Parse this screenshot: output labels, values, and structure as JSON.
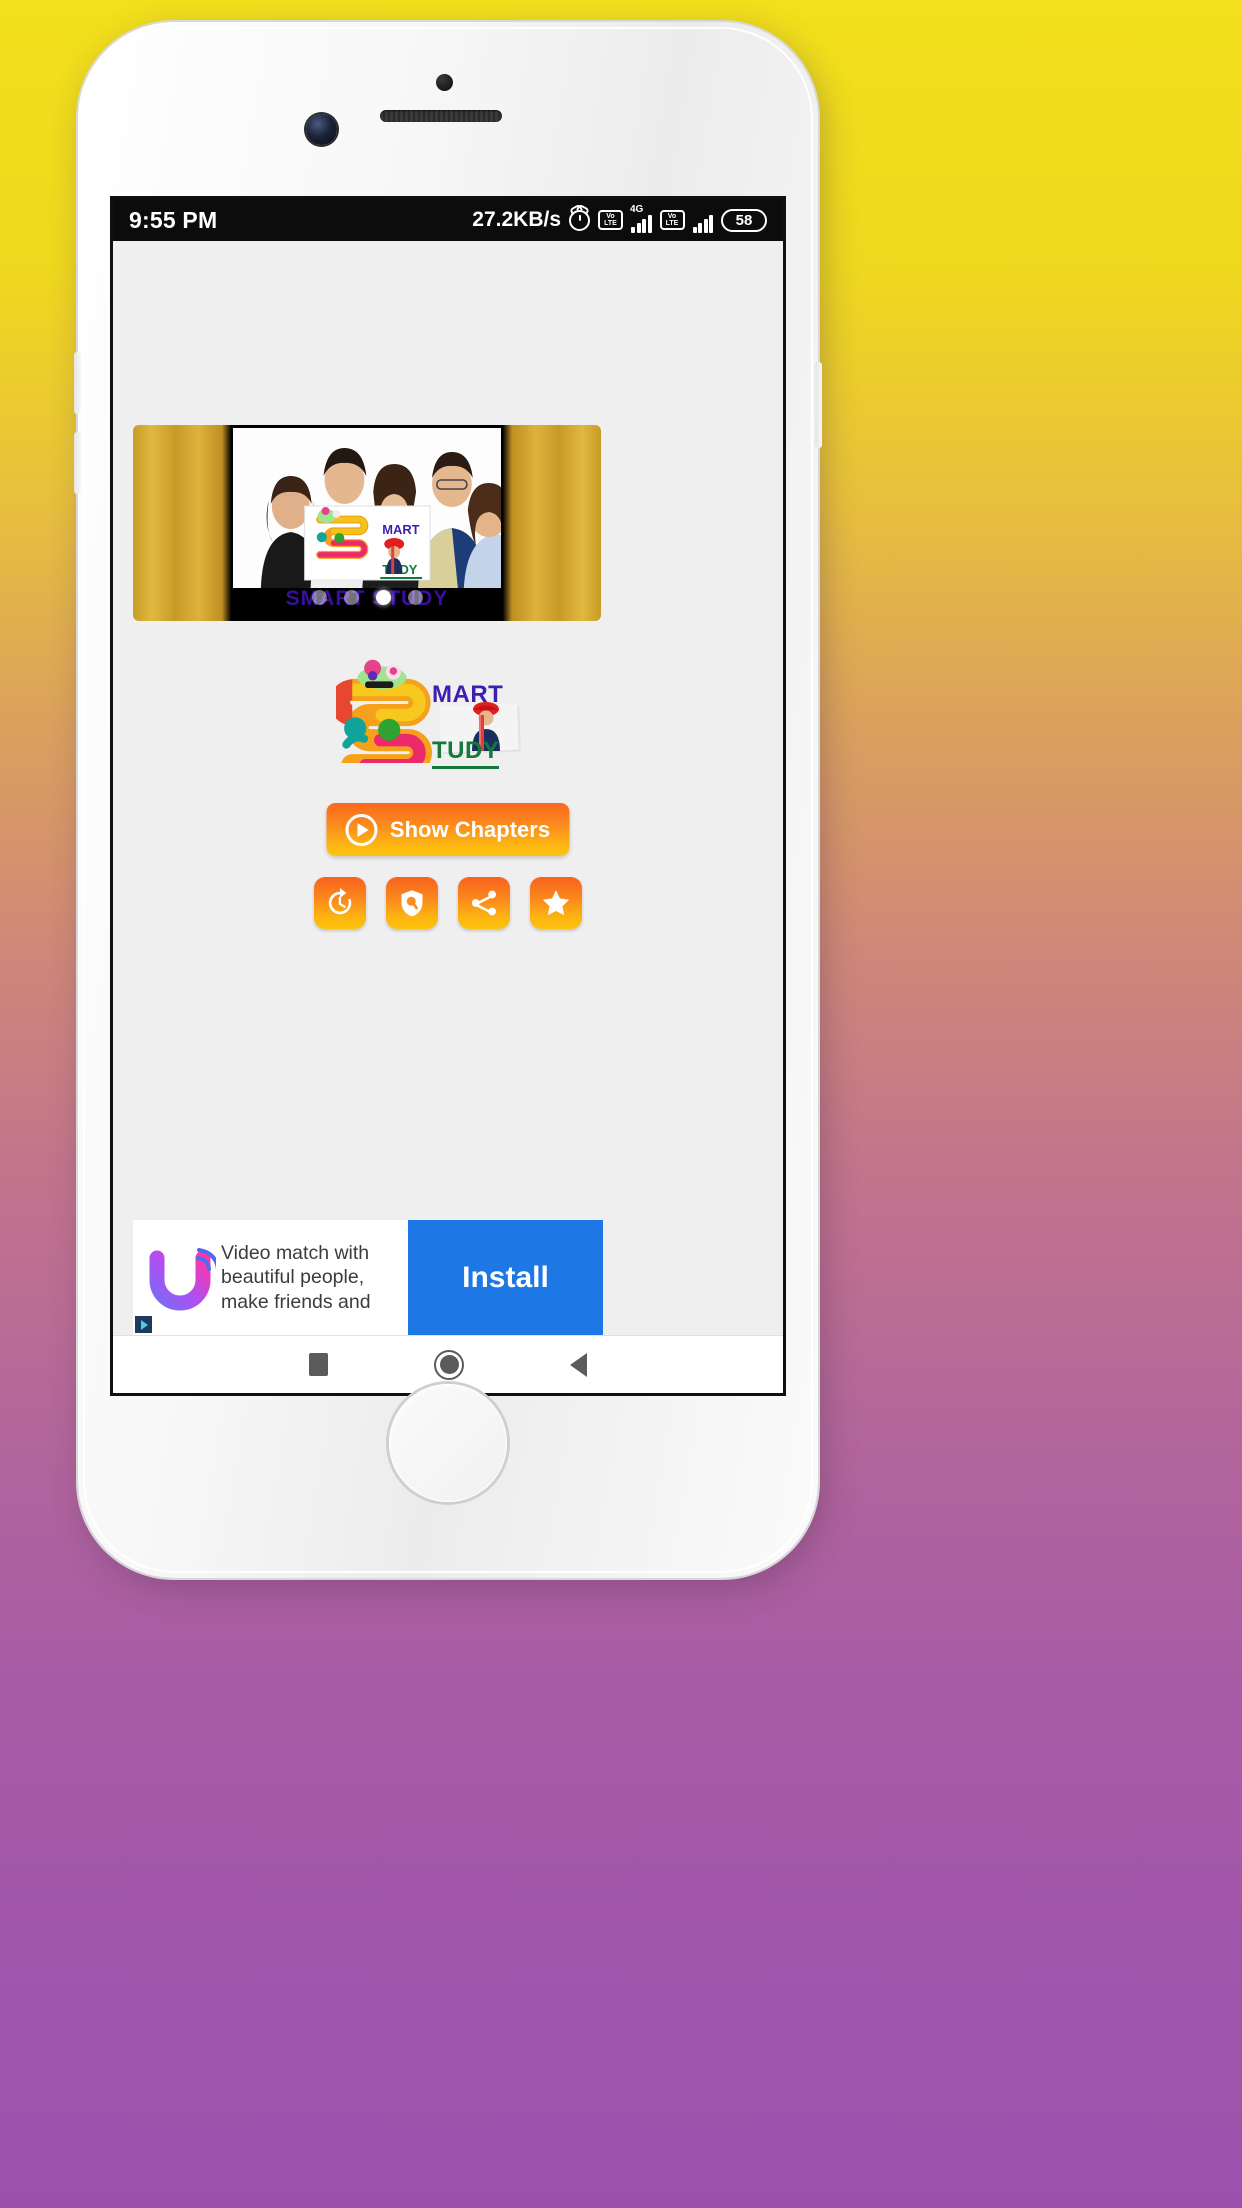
{
  "status_bar": {
    "time": "9:55 PM",
    "net_speed": "27.2KB/s",
    "alarm_icon": "alarm-clock-icon",
    "volte1_line1": "Vo",
    "volte1_line2": "LTE",
    "network_type": "4G",
    "volte2_line1": "Vo",
    "volte2_line2": "LTE",
    "battery_level": "58"
  },
  "carousel": {
    "caption": "SMART STUDY",
    "dots": [
      {
        "active": false
      },
      {
        "active": false
      },
      {
        "active": true
      },
      {
        "active": false
      }
    ],
    "slide_alt": "group of students holding SMART STUDY poster"
  },
  "logo": {
    "letter": "S",
    "mart": "MART",
    "tudy": "TUDY"
  },
  "actions": {
    "show_chapters_label": "Show Chapters",
    "play_icon": "play-circle-icon",
    "buttons": [
      {
        "name": "history-button",
        "icon": "clock-refresh-icon"
      },
      {
        "name": "privacy-policy-button",
        "icon": "shield-search-icon"
      },
      {
        "name": "share-button",
        "icon": "share-icon"
      },
      {
        "name": "rate-app-button",
        "icon": "star-icon"
      }
    ]
  },
  "ad": {
    "text": "Video match with beautiful people, make friends and",
    "install_label": "Install",
    "advertiser_icon": "u-app-logo-icon",
    "adchoices_icon": "adchoices-icon"
  },
  "navbar": {
    "recent_label": "recent-apps",
    "home_label": "home",
    "back_label": "back"
  },
  "colors": {
    "accent_orange_start": "#f8621f",
    "accent_orange_end": "#fec20c",
    "install_blue": "#1d78e6",
    "logo_purple": "#3c1fb0",
    "logo_green": "#137a3a",
    "bg_top": "#f2e01c",
    "bg_bottom": "#9b52ae"
  }
}
